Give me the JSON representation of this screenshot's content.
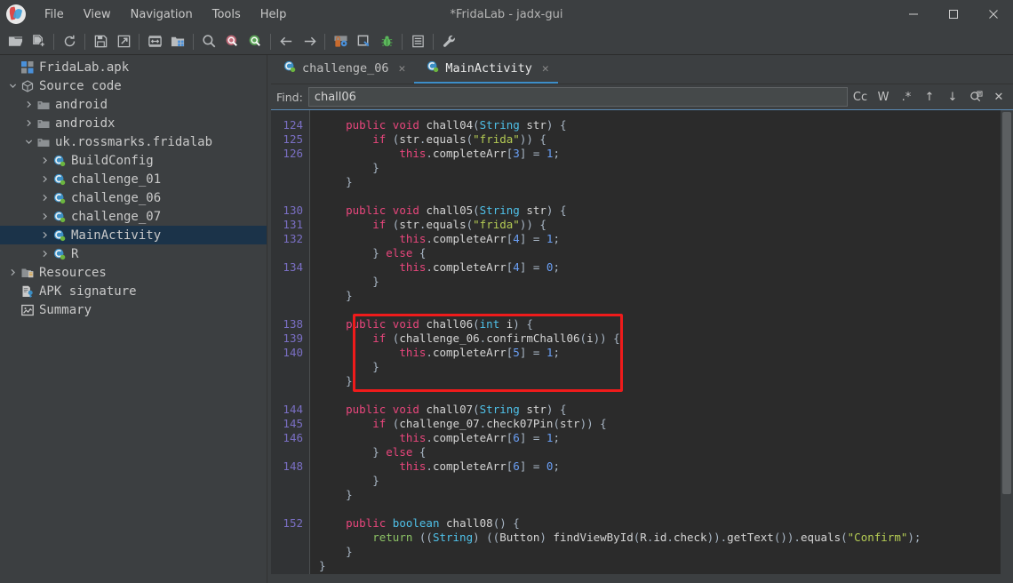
{
  "window": {
    "title": "*FridaLab - jadx-gui",
    "logo_icon": "jadx-logo-icon",
    "controls": [
      {
        "name": "minimize-button",
        "glyph": "—"
      },
      {
        "name": "maximize-button",
        "glyph": "☐"
      },
      {
        "name": "close-button",
        "glyph": "✕"
      }
    ]
  },
  "menubar": {
    "items": [
      {
        "label": "File",
        "name": "menu-file"
      },
      {
        "label": "View",
        "name": "menu-view"
      },
      {
        "label": "Navigation",
        "name": "menu-navigation"
      },
      {
        "label": "Tools",
        "name": "menu-tools"
      },
      {
        "label": "Help",
        "name": "menu-help"
      }
    ]
  },
  "toolbar": {
    "items": [
      {
        "name": "open-file-icon",
        "kind": "folder-open"
      },
      {
        "name": "add-files-icon",
        "kind": "file-add"
      },
      {
        "name": "sep",
        "kind": "separator"
      },
      {
        "name": "reload-icon",
        "kind": "reload"
      },
      {
        "name": "sep",
        "kind": "separator"
      },
      {
        "name": "save-all-icon",
        "kind": "save"
      },
      {
        "name": "export-gradle-icon",
        "kind": "export"
      },
      {
        "name": "sep",
        "kind": "separator"
      },
      {
        "name": "sync-with-tree-icon",
        "kind": "sync"
      },
      {
        "name": "flat-packages-icon",
        "kind": "packages"
      },
      {
        "name": "sep",
        "kind": "separator"
      },
      {
        "name": "search-icon",
        "kind": "search"
      },
      {
        "name": "search-class-icon",
        "kind": "search-red"
      },
      {
        "name": "search-method-icon",
        "kind": "search-green"
      },
      {
        "name": "sep",
        "kind": "separator"
      },
      {
        "name": "back-icon",
        "kind": "arrow-left"
      },
      {
        "name": "forward-icon",
        "kind": "arrow-right"
      },
      {
        "name": "sep",
        "kind": "separator"
      },
      {
        "name": "deobfuscation-icon",
        "kind": "deobf"
      },
      {
        "name": "quark-icon",
        "kind": "quark"
      },
      {
        "name": "debugger-icon",
        "kind": "bug"
      },
      {
        "name": "sep",
        "kind": "separator"
      },
      {
        "name": "logs-icon",
        "kind": "log"
      },
      {
        "name": "sep",
        "kind": "separator"
      },
      {
        "name": "preferences-icon",
        "kind": "wrench"
      }
    ]
  },
  "sidebar": {
    "tree": [
      {
        "label": "FridaLab.apk",
        "depth": 0,
        "twisty": "",
        "icon": "apk-icon",
        "name": "tree-item-fridalab-apk",
        "selected": false
      },
      {
        "label": "Source code",
        "depth": 0,
        "twisty": "v",
        "icon": "source-code-icon",
        "name": "tree-item-source-code",
        "selected": false
      },
      {
        "label": "android",
        "depth": 1,
        "twisty": ">",
        "icon": "package-icon",
        "name": "tree-item-android",
        "selected": false
      },
      {
        "label": "androidx",
        "depth": 1,
        "twisty": ">",
        "icon": "package-icon",
        "name": "tree-item-androidx",
        "selected": false
      },
      {
        "label": "uk.rossmarks.fridalab",
        "depth": 1,
        "twisty": "v",
        "icon": "package-icon",
        "name": "tree-item-uk-rossmarks-fridalab",
        "selected": false
      },
      {
        "label": "BuildConfig",
        "depth": 2,
        "twisty": ">",
        "icon": "class-icon",
        "name": "tree-item-buildconfig",
        "selected": false
      },
      {
        "label": "challenge_01",
        "depth": 2,
        "twisty": ">",
        "icon": "class-icon",
        "name": "tree-item-challenge-01",
        "selected": false
      },
      {
        "label": "challenge_06",
        "depth": 2,
        "twisty": ">",
        "icon": "class-icon",
        "name": "tree-item-challenge-06",
        "selected": false
      },
      {
        "label": "challenge_07",
        "depth": 2,
        "twisty": ">",
        "icon": "class-icon",
        "name": "tree-item-challenge-07",
        "selected": false
      },
      {
        "label": "MainActivity",
        "depth": 2,
        "twisty": ">",
        "icon": "class-icon",
        "name": "tree-item-mainactivity",
        "selected": true
      },
      {
        "label": "R",
        "depth": 2,
        "twisty": ">",
        "icon": "class-icon",
        "name": "tree-item-r",
        "selected": false
      },
      {
        "label": "Resources",
        "depth": 0,
        "twisty": ">",
        "icon": "resources-icon",
        "name": "tree-item-resources",
        "selected": false
      },
      {
        "label": "APK signature",
        "depth": 0,
        "twisty": "",
        "icon": "signature-icon",
        "name": "tree-item-apk-signature",
        "selected": false
      },
      {
        "label": "Summary",
        "depth": 0,
        "twisty": "",
        "icon": "summary-icon",
        "name": "tree-item-summary",
        "selected": false
      }
    ]
  },
  "editor": {
    "tabs": [
      {
        "label": "challenge_06",
        "active": false,
        "name": "tab-challenge-06",
        "close_glyph": "✕"
      },
      {
        "label": "MainActivity",
        "active": true,
        "name": "tab-mainactivity",
        "close_glyph": "✕"
      }
    ],
    "find": {
      "label": "Find:",
      "value": "chall06",
      "placeholder": "",
      "buttons": [
        {
          "label": "Cc",
          "name": "match-case-button"
        },
        {
          "label": "W",
          "name": "whole-word-button"
        },
        {
          "label": ".*",
          "name": "regex-button"
        },
        {
          "label": "↑",
          "name": "find-previous-button"
        },
        {
          "label": "↓",
          "name": "find-next-button"
        },
        {
          "label": "",
          "name": "search-all-icon"
        },
        {
          "label": "✕",
          "name": "close-find-button"
        }
      ]
    },
    "highlight_color": "#ef1b1b",
    "lines": [
      {
        "num": "124",
        "html": "    <span class='kwp'>public</span> <span class='kwp'>void</span> <span class='id'>chall04</span>(<span class='type'>String</span> <span class='id'>str</span>) {"
      },
      {
        "num": "125",
        "html": "        <span class='kwp'>if</span> (<span class='id'>str</span>.<span class='id'>equals</span>(<span class='str'>\"frida\"</span>)) {"
      },
      {
        "num": "126",
        "html": "            <span class='ths'>this</span>.<span class='id'>completeArr</span>[<span class='num'>3</span>] = <span class='num'>1</span>;"
      },
      {
        "num": "",
        "html": "        }"
      },
      {
        "num": "",
        "html": "    }"
      },
      {
        "num": "",
        "html": ""
      },
      {
        "num": "130",
        "html": "    <span class='kwp'>public</span> <span class='kwp'>void</span> <span class='id'>chall05</span>(<span class='type'>String</span> <span class='id'>str</span>) {"
      },
      {
        "num": "131",
        "html": "        <span class='kwp'>if</span> (<span class='id'>str</span>.<span class='id'>equals</span>(<span class='str'>\"frida\"</span>)) {"
      },
      {
        "num": "132",
        "html": "            <span class='ths'>this</span>.<span class='id'>completeArr</span>[<span class='num'>4</span>] = <span class='num'>1</span>;"
      },
      {
        "num": "",
        "html": "        } <span class='kwp'>else</span> {"
      },
      {
        "num": "134",
        "html": "            <span class='ths'>this</span>.<span class='id'>completeArr</span>[<span class='num'>4</span>] = <span class='num'>0</span>;"
      },
      {
        "num": "",
        "html": "        }"
      },
      {
        "num": "",
        "html": "    }"
      },
      {
        "num": "",
        "html": ""
      },
      {
        "num": "138",
        "html": "    <span class='kwp'>public</span> <span class='kwp'>void</span> <span class='id'>chall06</span>(<span class='type'>int</span> <span class='id'>i</span>) {"
      },
      {
        "num": "139",
        "html": "        <span class='kwp'>if</span> (<span class='id'>challenge_06</span>.<span class='id'>confirmChall06</span>(<span class='id'>i</span>)) {"
      },
      {
        "num": "140",
        "html": "            <span class='ths'>this</span>.<span class='id'>completeArr</span>[<span class='num'>5</span>] = <span class='num'>1</span>;"
      },
      {
        "num": "",
        "html": "        }"
      },
      {
        "num": "",
        "html": "    }"
      },
      {
        "num": "",
        "html": ""
      },
      {
        "num": "144",
        "html": "    <span class='kwp'>public</span> <span class='kwp'>void</span> <span class='id'>chall07</span>(<span class='type'>String</span> <span class='id'>str</span>) {"
      },
      {
        "num": "145",
        "html": "        <span class='kwp'>if</span> (<span class='id'>challenge_07</span>.<span class='id'>check07Pin</span>(<span class='id'>str</span>)) {"
      },
      {
        "num": "146",
        "html": "            <span class='ths'>this</span>.<span class='id'>completeArr</span>[<span class='num'>6</span>] = <span class='num'>1</span>;"
      },
      {
        "num": "",
        "html": "        } <span class='kwp'>else</span> {"
      },
      {
        "num": "148",
        "html": "            <span class='ths'>this</span>.<span class='id'>completeArr</span>[<span class='num'>6</span>] = <span class='num'>0</span>;"
      },
      {
        "num": "",
        "html": "        }"
      },
      {
        "num": "",
        "html": "    }"
      },
      {
        "num": "",
        "html": ""
      },
      {
        "num": "152",
        "html": "    <span class='kwp'>public</span> <span class='type'>boolean</span> <span class='id'>chall08</span>() {"
      },
      {
        "num": "",
        "html": "        <span class='ret'>return</span> ((<span class='type'>String</span>) ((<span class='id'>Button</span>) <span class='id'>findViewById</span>(<span class='id'>R</span>.<span class='id'>id</span>.<span class='id'>check</span>)).<span class='id'>getText</span>()).<span class='id'>equals</span>(<span class='str'>\"Confirm\"</span>);"
      },
      {
        "num": "",
        "html": "    }"
      },
      {
        "num": "",
        "html": "}"
      }
    ]
  }
}
